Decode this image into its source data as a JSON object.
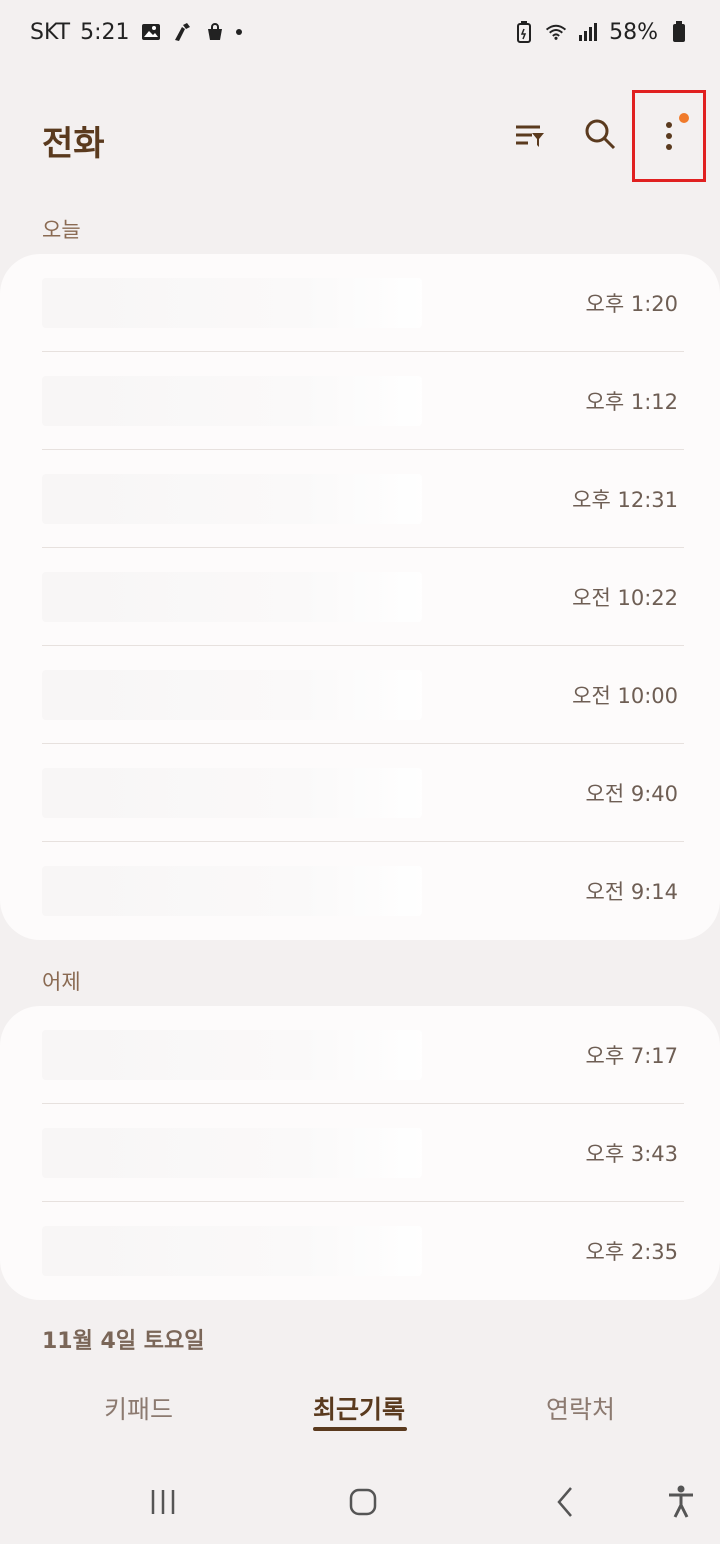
{
  "status_bar": {
    "carrier": "SKT",
    "time": "5:21",
    "battery": "58%",
    "icons_left": [
      "image-icon",
      "sketch-icon",
      "shopping-bag-icon",
      "dot-icon"
    ],
    "icons_right": [
      "battery-saver-icon",
      "wifi-icon",
      "signal-icon",
      "battery-icon"
    ]
  },
  "header": {
    "title": "전화",
    "actions": [
      "filter-icon",
      "search-icon",
      "more-options-icon"
    ],
    "notification_dot_color": "#f07a2a",
    "highlight_color": "#e02020"
  },
  "sections": [
    {
      "label": "오늘",
      "rows": [
        {
          "time": "오후 1:20"
        },
        {
          "time": "오후 1:12"
        },
        {
          "time": "오후 12:31"
        },
        {
          "time": "오전 10:22"
        },
        {
          "time": "오전 10:00"
        },
        {
          "time": "오전 9:40"
        },
        {
          "time": "오전 9:14"
        }
      ]
    },
    {
      "label": "어제",
      "rows": [
        {
          "time": "오후 7:17"
        },
        {
          "time": "오후 3:43"
        },
        {
          "time": "오후 2:35"
        }
      ]
    }
  ],
  "next_section_label": "11월 4일 토요일",
  "tabs": {
    "keypad": "키패드",
    "recents": "최근기록",
    "contacts": "연락처",
    "active": "recents"
  },
  "nav": [
    "recent-apps-icon",
    "home-icon",
    "back-icon",
    "accessibility-icon"
  ],
  "colors": {
    "background": "#f3f0f0",
    "card": "#fdfbfb",
    "accent_text": "#5a3a1e"
  }
}
